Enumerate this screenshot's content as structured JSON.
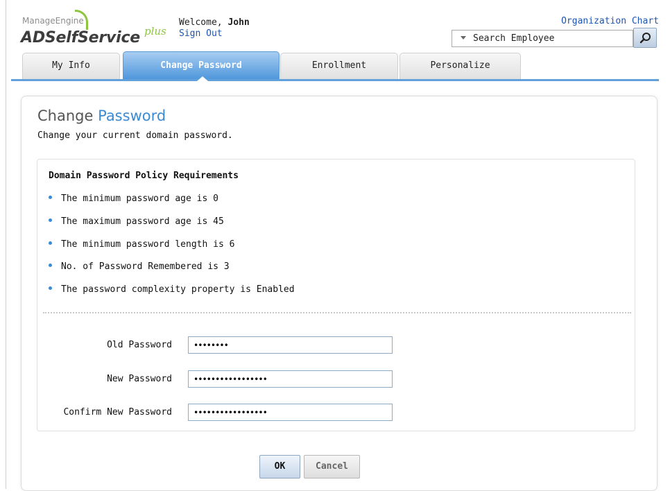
{
  "header": {
    "brand_small": "ManageEngine",
    "brand_main": "ADSelfService",
    "brand_plus": "plus",
    "welcome_prefix": "Welcome,",
    "user_name": "John",
    "sign_out": "Sign Out",
    "org_chart": "Organization Chart",
    "search_placeholder": "Search Employee"
  },
  "tabs": [
    {
      "label": "My Info",
      "active": false
    },
    {
      "label": "Change Password",
      "active": true
    },
    {
      "label": "Enrollment",
      "active": false
    },
    {
      "label": "Personalize",
      "active": false
    }
  ],
  "page": {
    "title_plain": "Change",
    "title_accent": "Password",
    "subtitle": "Change your current domain password."
  },
  "policy": {
    "heading": "Domain Password Policy Requirements",
    "items": [
      "The minimum password age is 0",
      "The maximum password age is 45",
      "The minimum password length is 6",
      "No. of Password Remembered is 3",
      "The password complexity property is Enabled"
    ]
  },
  "form": {
    "old_label": "Old Password",
    "old_value": "••••••••",
    "new_label": "New Password",
    "new_value": "•••••••••••••••••",
    "confirm_label": "Confirm New Password",
    "confirm_value": "•••••••••••••••••"
  },
  "buttons": {
    "ok": "OK",
    "cancel": "Cancel"
  },
  "colors": {
    "accent": "#3b8bd4",
    "tab_active": "#4f97dc",
    "brand_green": "#8cc63f",
    "link": "#1a55b3"
  }
}
